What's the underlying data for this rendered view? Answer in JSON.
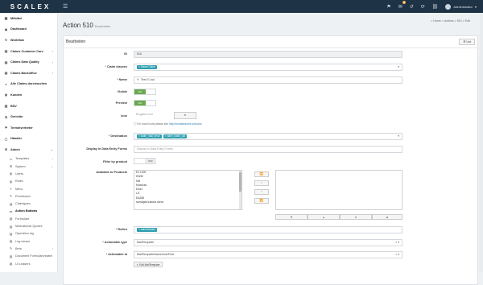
{
  "topbar": {
    "logo": "SCALEX",
    "toggle": "☰",
    "badge": "4",
    "user": "Administrator"
  },
  "nav": [
    {
      "name": "nav-mitbibel",
      "icon": "▦",
      "label": "Mitbibel",
      "arrow": "",
      "style": "bold"
    },
    {
      "name": "nav-dashboard",
      "icon": "◉",
      "label": "Dashboard",
      "arrow": "",
      "style": "bold"
    },
    {
      "name": "nav-workflow",
      "icon": "↻",
      "label": "Workflow",
      "arrow": "",
      "style": "bold"
    },
    {
      "name": "nav-claims-customer-care",
      "icon": "▤",
      "label": "Claims Customer Care",
      "arrow": "‹",
      "style": "bold"
    },
    {
      "name": "nav-claims-data-quality",
      "icon": "▤",
      "label": "Claims Data Quality",
      "arrow": "‹",
      "style": "bold"
    },
    {
      "name": "nav-claims-backoffice",
      "icon": "▤",
      "label": "Claims Backoffice",
      "arrow": "‹",
      "style": "bold"
    },
    {
      "name": "nav-alle-claims",
      "icon": "⌕",
      "label": "Alle Claims durchsuchen",
      "arrow": "",
      "style": "bold"
    },
    {
      "name": "nav-kunden",
      "icon": "◍",
      "label": "Kunden",
      "arrow": "",
      "style": "bold"
    },
    {
      "name": "nav-bsv",
      "icon": "▥",
      "label": "BSV",
      "arrow": "",
      "style": "bold"
    },
    {
      "name": "nav-gerichte",
      "icon": "⚖",
      "label": "Gerichte",
      "arrow": "",
      "style": "bold"
    },
    {
      "name": "nav-terminvertreter",
      "icon": "⚑",
      "label": "Terminvertreter",
      "arrow": "",
      "style": "bold"
    },
    {
      "name": "nav-haendler",
      "icon": "▢",
      "label": "Händler",
      "arrow": "",
      "style": "bold"
    },
    {
      "name": "nav-admin",
      "icon": "⚙",
      "label": "Admin",
      "arrow": "⌄",
      "style": "bold"
    },
    {
      "name": "nav-templates",
      "icon": "▭",
      "label": "Templates",
      "arrow": "‹",
      "style": "sub"
    },
    {
      "name": "nav-system",
      "icon": "⚙",
      "label": "System",
      "arrow": "⌄",
      "style": "sub"
    },
    {
      "name": "nav-users",
      "icon": "◍",
      "label": "Users",
      "arrow": "",
      "style": "sub"
    },
    {
      "name": "nav-roles",
      "icon": "◍",
      "label": "Roles",
      "arrow": "",
      "style": "sub"
    },
    {
      "name": "nav-menu",
      "icon": "≡",
      "label": "Menu",
      "arrow": "",
      "style": "sub"
    },
    {
      "name": "nav-permission",
      "icon": "✎",
      "label": "Permission",
      "arrow": "",
      "style": "sub"
    },
    {
      "name": "nav-claimtypes",
      "icon": "▤",
      "label": "Claimtypes",
      "arrow": "",
      "style": "sub"
    },
    {
      "name": "nav-action-buttons",
      "icon": "▭",
      "label": "Action Buttons",
      "arrow": "",
      "style": "sub active"
    },
    {
      "name": "nav-formulare",
      "icon": "▤",
      "label": "Formulare",
      "arrow": "",
      "style": "sub"
    },
    {
      "name": "nav-motivational-quotes",
      "icon": "▤",
      "label": "Motivational Quotes",
      "arrow": "",
      "style": "sub"
    },
    {
      "name": "nav-operation-log",
      "icon": "▤",
      "label": "Operation log",
      "arrow": "",
      "style": "sub"
    },
    {
      "name": "nav-log-viewer",
      "icon": "▤",
      "label": "Log viewer",
      "arrow": "",
      "style": "sub"
    },
    {
      "name": "nav-beta",
      "icon": "✎",
      "label": "Beta",
      "arrow": "‹",
      "style": "sub"
    },
    {
      "name": "nav-document-formularkreaten",
      "icon": "▤",
      "label": "Document Formularkreaten",
      "arrow": "",
      "style": "sub"
    },
    {
      "name": "nav-ui-leaders",
      "icon": "▤",
      "label": "UI Leaders",
      "arrow": "",
      "style": "sub"
    }
  ],
  "page": {
    "title": "Action 510",
    "subtitle": "Bearbeiten"
  },
  "breadcrumb": {
    "home": "Home",
    "actions": "Actions",
    "id": "510",
    "edit": "Edit"
  },
  "box": {
    "title": "Bearbeiten",
    "list_button": "List"
  },
  "form": {
    "id_label": "ID",
    "id_value": "510",
    "claim_classes_label": "Claim classes",
    "claim_classes_tag": "Diesel Claim",
    "name_label": "Name",
    "name_value": "Test 0 Lad",
    "visible_label": "Visible",
    "visible_toggle": "ON",
    "preview_label": "Preview",
    "preview_toggle": "ON",
    "icon_label": "Icon",
    "icon_placeholder": "Eingabe Icon",
    "icon_hint": "For more icons please see",
    "icon_hint_link": "http://fontawesome.io/icons/",
    "destination_label": "Destination",
    "destination_tag1": "claim_mail_send",
    "destination_tag2": "claim_batch_job",
    "display_label": "Display in Data Entry Forms",
    "display_placeholder": "Display in Data Entry Forms",
    "filter_label": "Filter by product",
    "filter_toggle": "OFF",
    "products_label": "Available to Products",
    "products": [
      "E3 LKW",
      "KW30",
      "MB",
      "Motorrad",
      "EA44",
      "LG",
      "EA288",
      "sonstiges/Labora sonst"
    ],
    "rollen_label": "Rollen",
    "rollen_tag": "Administrator",
    "actionable_type_label": "Actionable type",
    "actionable_type_value": "MailTemplate",
    "actionable_id_label": "Actionable id",
    "actionable_id_value": "MailTemplateNameInnerFirst",
    "edit_button": "Edit MailTemplate"
  },
  "icons": {
    "toggle": "menu-icon",
    "required_color": "#c0392b",
    "accent": "#2c9fb0",
    "toggle_on_color": "#6aa94f"
  }
}
